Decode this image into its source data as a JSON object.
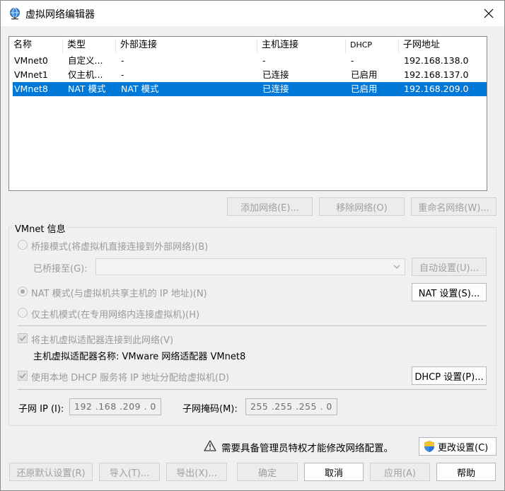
{
  "window": {
    "title": "虚拟网络编辑器"
  },
  "table": {
    "headers": [
      "名称",
      "类型",
      "外部连接",
      "主机连接",
      "DHCP",
      "子网地址"
    ],
    "rows": [
      [
        "VMnet0",
        "自定义...",
        "-",
        "-",
        "-",
        "192.168.138.0"
      ],
      [
        "VMnet1",
        "仅主机...",
        "-",
        "已连接",
        "已启用",
        "192.168.137.0"
      ],
      [
        "VMnet8",
        "NAT 模式",
        "NAT 模式",
        "已连接",
        "已启用",
        "192.168.209.0"
      ]
    ],
    "selected_row": 2
  },
  "list_buttons": {
    "add": "添加网络(E)...",
    "remove": "移除网络(O)",
    "rename": "重命名网络(W)..."
  },
  "vmnet_info": {
    "group_title": "VMnet 信息",
    "bridged_label": "桥接模式(将虚拟机直接连接到外部网络)(B)",
    "bridged_to_label": "已桥接至(G):",
    "auto_settings": "自动设置(U)...",
    "nat_label": "NAT 模式(与虚拟机共享主机的 IP 地址)(N)",
    "nat_settings": "NAT 设置(S)...",
    "hostonly_label": "仅主机模式(在专用网络内连接虚拟机)(H)",
    "connect_adapter_label": "将主机虚拟适配器连接到此网络(V)",
    "adapter_name_text": "主机虚拟适配器名称: VMware 网络适配器 VMnet8",
    "dhcp_label": "使用本地 DHCP 服务将 IP 地址分配给虚拟机(D)",
    "dhcp_settings": "DHCP 设置(P)...",
    "subnet_ip_label": "子网 IP (I):",
    "subnet_ip_value": "192 .168 .209 .  0",
    "subnet_mask_label": "子网掩码(M):",
    "subnet_mask_value": "255 .255 .255 .  0"
  },
  "admin": {
    "warning_text": "需要具备管理员特权才能修改网络配置。",
    "change_settings": "更改设置(C)"
  },
  "footer": {
    "restore": "还原默认设置(R)",
    "import": "导入(T)...",
    "export": "导出(X)...",
    "ok": "确定",
    "cancel": "取消",
    "apply": "应用(A)",
    "help": "帮助"
  },
  "colors": {
    "selection": "#0078d7",
    "disabled_text": "#a0a0a0"
  }
}
